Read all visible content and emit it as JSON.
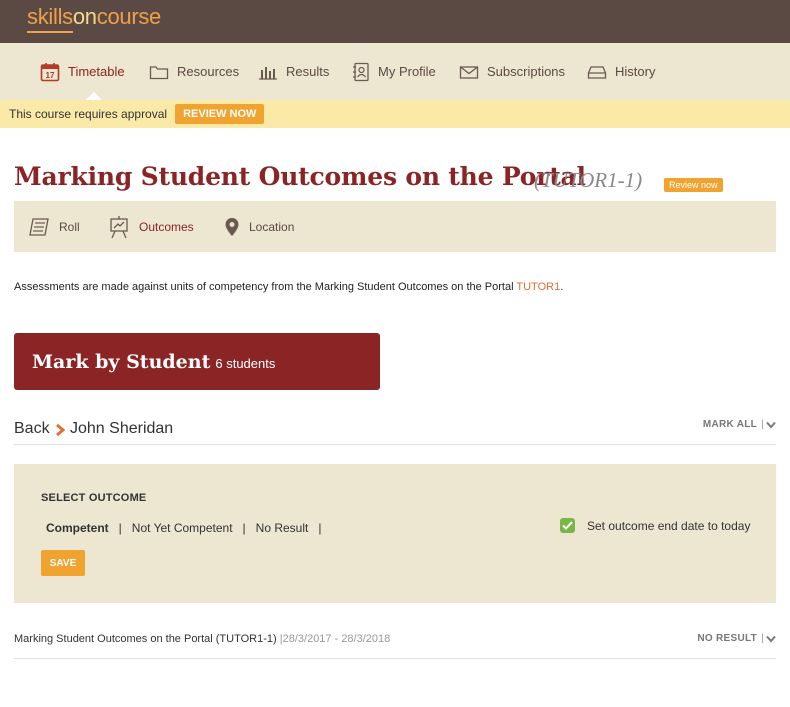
{
  "brand": {
    "part1": "skills",
    "part2": "on",
    "part3": "course"
  },
  "nav": [
    {
      "label": "Timetable",
      "icon": "calendar-icon"
    },
    {
      "label": "Resources",
      "icon": "folder-icon"
    },
    {
      "label": "Results",
      "icon": "bar-chart-icon"
    },
    {
      "label": "My Profile",
      "icon": "profile-book-icon"
    },
    {
      "label": "Subscriptions",
      "icon": "envelope-icon"
    },
    {
      "label": "History",
      "icon": "inbox-tray-icon"
    }
  ],
  "approval": {
    "text": "This course requires approval",
    "button": "REVIEW NOW"
  },
  "course": {
    "title": "Marking Student Outcomes on the Portal",
    "code": "(TUTOR1-1)",
    "review_badge": "Review now"
  },
  "subnav": [
    {
      "label": "Roll",
      "icon": "roll-list-icon"
    },
    {
      "label": "Outcomes",
      "icon": "easel-chart-icon"
    },
    {
      "label": "Location",
      "icon": "map-pin-icon"
    }
  ],
  "intro": {
    "text": "Assessments are made against units of competency from the Marking Student Outcomes on the Portal ",
    "link": "TUTOR1",
    "suffix": "."
  },
  "mark_box": {
    "title": "Mark by Student",
    "count": "6 students"
  },
  "breadcrumb": {
    "back": "Back",
    "student": "John Sheridan",
    "mark_all": "MARK ALL"
  },
  "outcome_panel": {
    "heading": "SELECT OUTCOME",
    "options": [
      "Competent",
      "Not Yet Competent",
      "No Result"
    ],
    "selected": "Competent",
    "end_date_label": "Set outcome end date to today",
    "end_date_checked": true,
    "save": "SAVE"
  },
  "result": {
    "title": "Marking Student Outcomes on the Portal (TUTOR1-1)",
    "dates": "|28/3/2017 - 28/3/2018",
    "status": "NO RESULT"
  },
  "colors": {
    "topbar": "#5b4a44",
    "maroon": "#8b2525",
    "orange": "#f0a32e",
    "beige": "#ede6d0",
    "yellow": "#fbe9a8",
    "green": "#7ab648"
  }
}
